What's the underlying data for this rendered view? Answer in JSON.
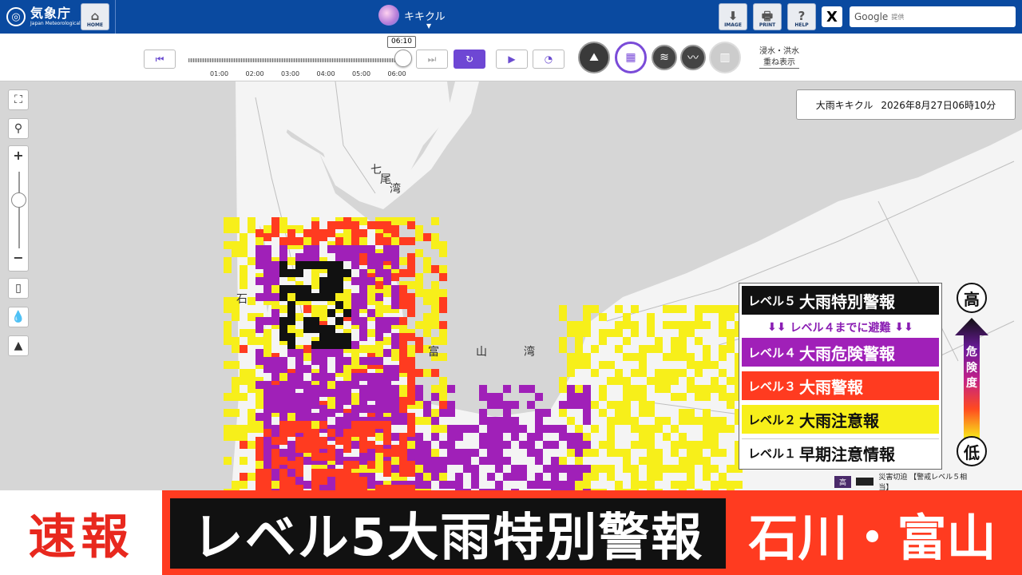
{
  "header": {
    "agency_name": "気象庁",
    "agency_name_en": "Japan Meteorological Agency",
    "home_label": "HOME",
    "app_title": "キキクル",
    "image_label": "IMAGE",
    "print_label": "PRINT",
    "help_label": "HELP",
    "x_label": "X",
    "search_brand": "Google",
    "search_suffix": "提供"
  },
  "toolbar": {
    "current_time": "06:10",
    "ticks": [
      "01:00",
      "02:00",
      "03:00",
      "04:00",
      "05:00",
      "06:00"
    ],
    "overlay_line1": "浸水・洪水",
    "overlay_line2": "重ね表示"
  },
  "map": {
    "timestamp_title": "大雨キキクル",
    "timestamp_value": "2026年8月27日06時10分",
    "labels": {
      "ishikawa": "石",
      "toyama_bay_1": "富",
      "toyama_bay_2": "山",
      "toyama_bay_3": "湾",
      "nanao_1": "七",
      "nanao_2": "尾",
      "nanao_3": "湾"
    }
  },
  "legend": {
    "rows": [
      {
        "level": "レベル５",
        "name": "大雨特別警報",
        "color": "#111111",
        "text_color": "#ffffff"
      },
      {
        "level": "レベル４",
        "name": "大雨危険警報",
        "color": "#a020b8",
        "text_color": "#ffffff"
      },
      {
        "level": "レベル３",
        "name": "大雨警報",
        "color": "#ff3b20",
        "text_color": "#ffffff"
      },
      {
        "level": "レベル２",
        "name": "大雨注意報",
        "color": "#f7ef1a",
        "text_color": "#111111"
      },
      {
        "level": "レベル１",
        "name": "早期注意情報",
        "color": "#ffffff",
        "text_color": "#111111"
      }
    ],
    "evacuation_note": "レベル４までに避難",
    "high_label": "高",
    "low_label": "低",
    "danger_label": "危険度",
    "mini_high": "高",
    "mini_key_text": "災害切迫 【警戒レベル５相当】"
  },
  "ticker": {
    "breaking": "速報",
    "headline": "レベル5大雨特別警報",
    "places": "石川・富山"
  },
  "colors": {
    "header_blue": "#0a4aa0",
    "level5": "#111111",
    "level4": "#a020b8",
    "level3": "#ff3b20",
    "level2": "#f7ef1a",
    "accent_purple": "#6e47d4",
    "ticker_red": "#ff3b20"
  }
}
